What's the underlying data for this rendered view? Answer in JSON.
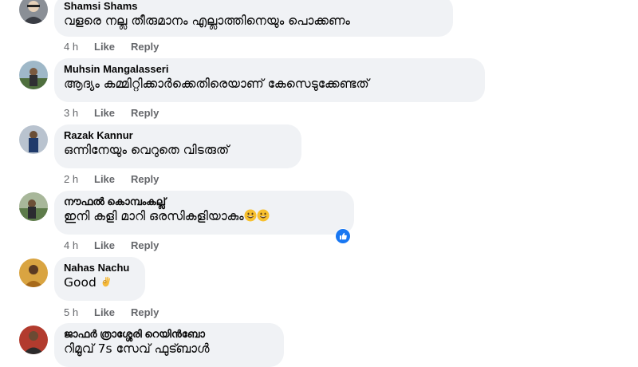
{
  "comments": [
    {
      "author": "Shamsi Shams",
      "text": "വളരെ നല്ല തീരുമാനം എല്ലാത്തിനെയും പൊക്കണം",
      "time": "4 h",
      "like": "Like",
      "reply": "Reply"
    },
    {
      "author": "Muhsin Mangalasseri",
      "text": "ആദ്യം കമ്മിറ്റിക്കാർക്കെതിരെയാണ് കേസെടുക്കേണ്ടത്",
      "time": "3 h",
      "like": "Like",
      "reply": "Reply"
    },
    {
      "author": "Razak Kannur",
      "text": "ഒന്നിനേയും വെറുതെ വിടരുത്",
      "time": "2 h",
      "like": "Like",
      "reply": "Reply"
    },
    {
      "author": "നൗഫൽ കൊമ്പംകല്ല്",
      "text": "ഇനി കളി മാറി ഒരസികളിയാകും",
      "time": "4 h",
      "like": "Like",
      "reply": "Reply",
      "emojis": [
        "grinning-face-icon",
        "grinning-face-icon"
      ],
      "reaction": "like-reaction-icon"
    },
    {
      "author": "Nahas Nachu",
      "text": "Good",
      "time": "5 h",
      "like": "Like",
      "reply": "Reply",
      "emojis": [
        "ok-hand-icon"
      ]
    },
    {
      "author": "ജാഫർ ത്രാശ്ശേരി റെയിൻബോ",
      "text": "റിമൂവ് 7s സേവ് ഫുട്ബാൾ"
    }
  ],
  "colors": {
    "bubble": "#f0f2f5",
    "meta": "#65676b",
    "like_blue": "#1877f2"
  }
}
